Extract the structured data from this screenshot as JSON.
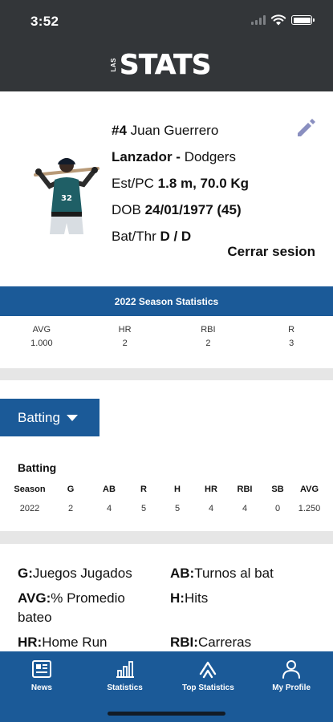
{
  "status": {
    "time": "3:52"
  },
  "logo": {
    "small": "LAS",
    "big": "STATS"
  },
  "profile": {
    "number": "#4",
    "name": "Juan Guerrero",
    "position": "Lanzador -",
    "team": "Dodgers",
    "height_weight_label": "Est/PC",
    "height_weight": "1.8 m, 70.0 Kg",
    "dob_label": "DOB",
    "dob": "24/01/1977 (45)",
    "bat_throw_label": "Bat/Thr",
    "bat_throw": "D / D",
    "logout_label": "Cerrar sesion"
  },
  "season": {
    "title": "2022  Season Statistics",
    "stats": [
      {
        "label": "AVG",
        "value": "1.000"
      },
      {
        "label": "HR",
        "value": "2"
      },
      {
        "label": "RBI",
        "value": "2"
      },
      {
        "label": "R",
        "value": "3"
      }
    ]
  },
  "dropdown": {
    "selected": "Batting"
  },
  "batting": {
    "title": "Batting",
    "headers": [
      "Season",
      "G",
      "AB",
      "R",
      "H",
      "HR",
      "RBI",
      "SB",
      "AVG"
    ],
    "rows": [
      [
        "2022",
        "2",
        "4",
        "5",
        "5",
        "4",
        "4",
        "0",
        "1.250"
      ]
    ]
  },
  "legend": [
    {
      "abbr": "G:",
      "text": "Juegos Jugados"
    },
    {
      "abbr": "AB:",
      "text": "Turnos al bat"
    },
    {
      "abbr": "AVG:",
      "text": "% Promedio bateo"
    },
    {
      "abbr": "H:",
      "text": "Hits"
    },
    {
      "abbr": "HR:",
      "text": "Home Run"
    },
    {
      "abbr": "RBI:",
      "text": "Carreras"
    }
  ],
  "tabs": [
    {
      "label": "News",
      "icon": "news-icon"
    },
    {
      "label": "Statistics",
      "icon": "statistics-icon"
    },
    {
      "label": "Top Statistics",
      "icon": "top-statistics-icon"
    },
    {
      "label": "My Profile",
      "icon": "profile-icon"
    }
  ],
  "colors": {
    "header": "#333639",
    "accent": "#1b5a98",
    "edit_icon": "#8a8fc0",
    "separator": "#e6e6e6"
  }
}
